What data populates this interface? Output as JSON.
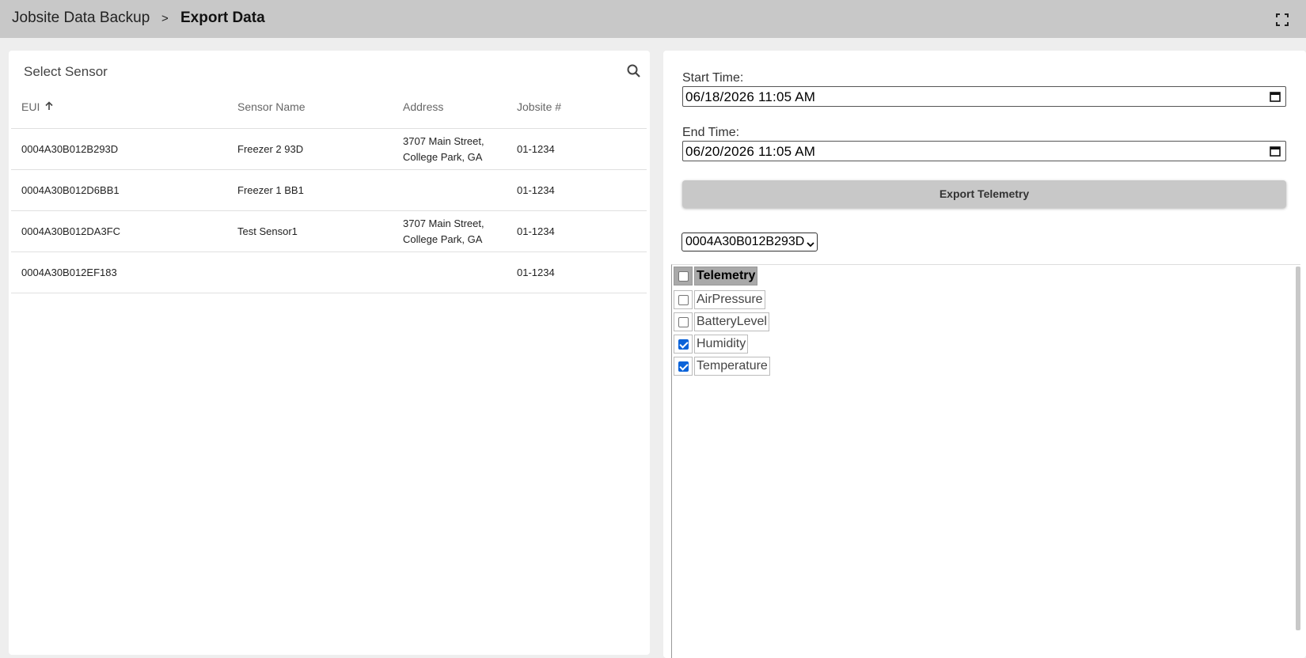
{
  "header": {
    "breadcrumb_root": "Jobsite Data Backup",
    "breadcrumb_separator": ">",
    "breadcrumb_current": "Export Data",
    "fullscreen_icon": "fullscreen-icon"
  },
  "sensor_panel": {
    "title": "Select Sensor",
    "search_icon": "search-icon",
    "columns": {
      "eui": "EUI",
      "sensor_name": "Sensor Name",
      "address": "Address",
      "jobsite": "Jobsite #"
    },
    "sort": {
      "column": "EUI",
      "direction": "ascending"
    },
    "rows": [
      {
        "eui": "0004A30B012B293D",
        "sensor_name": "Freezer 2 93D",
        "address_line1": "3707 Main Street,",
        "address_line2": "College Park, GA",
        "jobsite": "01-1234"
      },
      {
        "eui": "0004A30B012D6BB1",
        "sensor_name": "Freezer 1 BB1",
        "address_line1": "",
        "address_line2": "",
        "jobsite": "01-1234"
      },
      {
        "eui": "0004A30B012DA3FC",
        "sensor_name": "Test Sensor1",
        "address_line1": "3707 Main Street,",
        "address_line2": "College Park, GA",
        "jobsite": "01-1234"
      },
      {
        "eui": "0004A30B012EF183",
        "sensor_name": "",
        "address_line1": "",
        "address_line2": "",
        "jobsite": "01-1234"
      }
    ]
  },
  "export_panel": {
    "start_label": "Start Time:",
    "start_value": "06/18/2026 11:05 AM",
    "end_label": "End Time:",
    "end_value": "06/20/2026 11:05 AM",
    "export_button": "Export Telemetry",
    "selected_sensor": "0004A30B012B293D",
    "telemetry": {
      "header": "Telemetry",
      "header_checked": false,
      "items": [
        {
          "label": "AirPressure",
          "checked": false
        },
        {
          "label": "BatteryLevel",
          "checked": false
        },
        {
          "label": "Humidity",
          "checked": true
        },
        {
          "label": "Temperature",
          "checked": true
        }
      ]
    }
  },
  "colors": {
    "topbar": "#c8c8c8",
    "background": "#eeeeee",
    "checkbox_checked": "#0b63d9",
    "button": "#c8c8c8"
  }
}
